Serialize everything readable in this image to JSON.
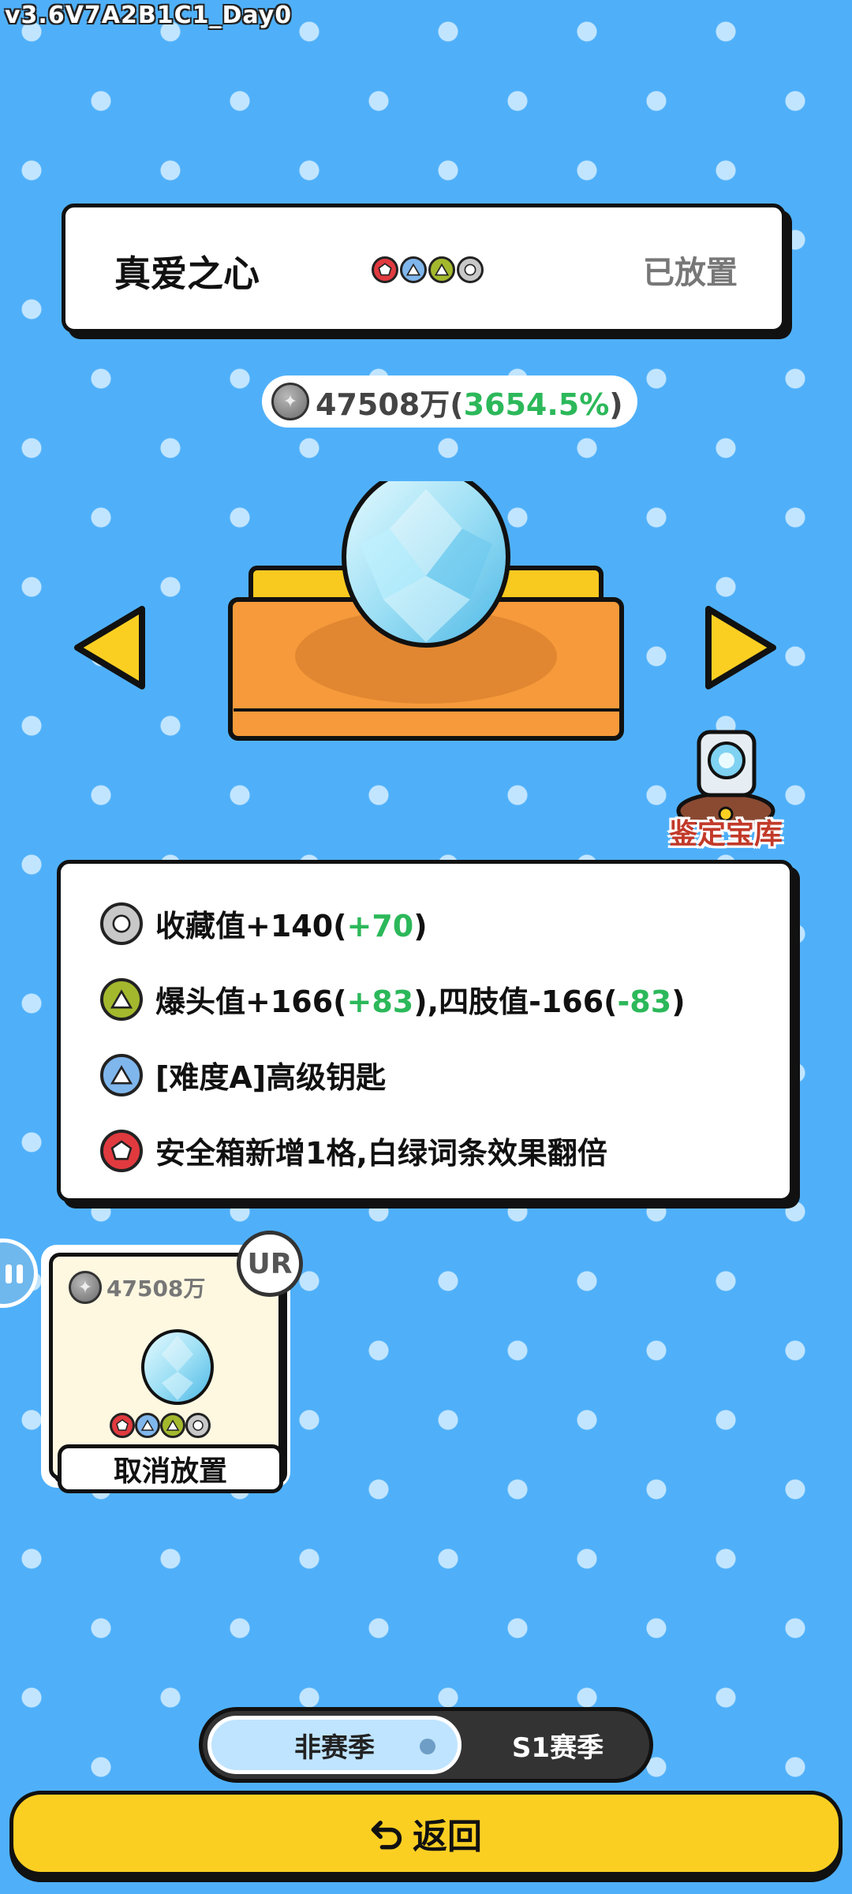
{
  "version": "v3.6V7A2B1C1_Day0",
  "header": {
    "title": "真爱之心",
    "status": "已放置",
    "badges": [
      "pentagon-red",
      "triangle-blue",
      "triangle-green",
      "circle-gray"
    ]
  },
  "value": {
    "amount": "47508万(",
    "percent": "3654.5%",
    "close": ")"
  },
  "vault": {
    "label": "鉴定宝库"
  },
  "effects": [
    {
      "icon": "circle-gray",
      "parts": [
        "收藏值+140(",
        "+70",
        ")"
      ]
    },
    {
      "icon": "triangle-green",
      "parts": [
        "爆头值+166(",
        "+83",
        "),四肢值-166(",
        "-83",
        ")"
      ]
    },
    {
      "icon": "triangle-blue",
      "text": "[难度A]高级钥匙"
    },
    {
      "icon": "pentagon-red",
      "text": "安全箱新增1格,白绿词条效果翻倍"
    }
  ],
  "item_card": {
    "price": "47508万",
    "rarity": "UR",
    "cancel_label": "取消放置"
  },
  "season_toggle": {
    "off_label": "非赛季",
    "s1_label": "S1赛季"
  },
  "back_button": {
    "label": "返回"
  },
  "colors": {
    "background": "#4fb0f9",
    "accent_yellow": "#fbcf22",
    "positive_green": "#2cb85a",
    "vault_red": "#c23a2a"
  }
}
